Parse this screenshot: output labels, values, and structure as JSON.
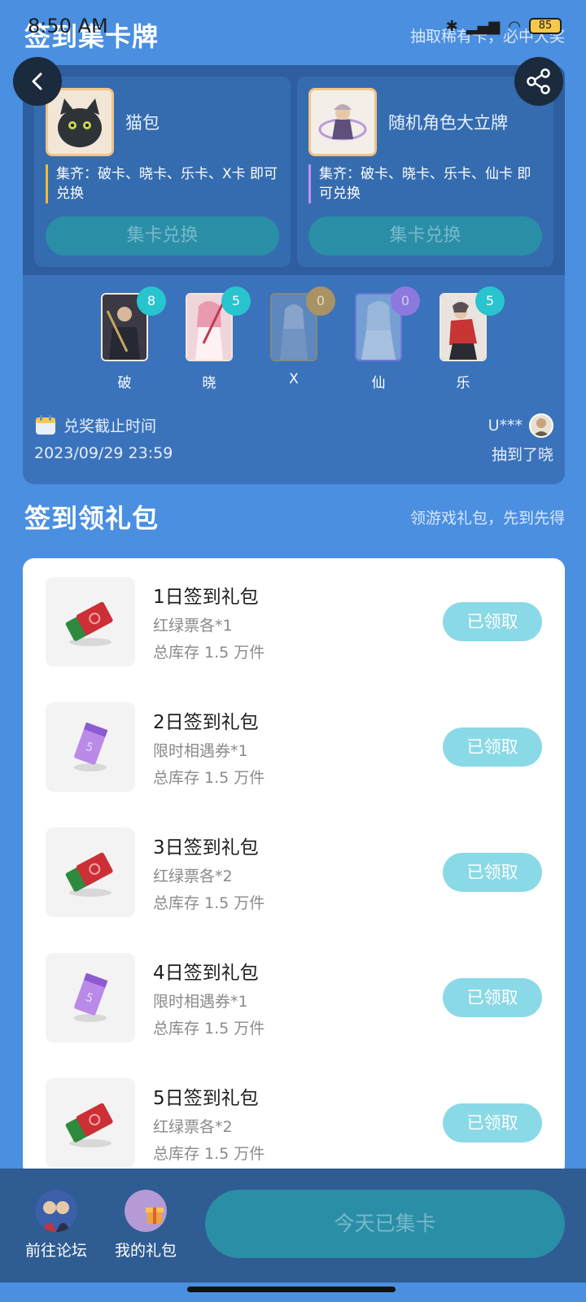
{
  "status_bar": {
    "time": "8:50 AM",
    "battery": "85"
  },
  "card_section": {
    "title": "签到集卡牌",
    "subtitle": "抽取稀有卡，必中大奖"
  },
  "rewards": [
    {
      "name": "猫包",
      "desc": "集齐：破卡、晓卡、乐卡、X卡 即可兑换",
      "button": "集卡兑换"
    },
    {
      "name": "随机角色大立牌",
      "desc": "集齐：破卡、晓卡、乐卡、仙卡 即可兑换",
      "button": "集卡兑换"
    }
  ],
  "cards": [
    {
      "label": "破",
      "count": "8"
    },
    {
      "label": "晓",
      "count": "5"
    },
    {
      "label": "X",
      "count": "0"
    },
    {
      "label": "仙",
      "count": "0"
    },
    {
      "label": "乐",
      "count": "5"
    }
  ],
  "deadline": {
    "label": "兑奖截止时间",
    "date": "2023/09/29 23:59"
  },
  "winner": {
    "user": "U***",
    "text": "抽到了晓"
  },
  "gift_section": {
    "title": "签到领礼包",
    "subtitle": "领游戏礼包，先到先得"
  },
  "gifts": [
    {
      "name": "1日签到礼包",
      "item": "红绿票各*1",
      "stock": "总库存 1.5 万件",
      "button": "已领取",
      "icon": "ticket-pair-icon"
    },
    {
      "name": "2日签到礼包",
      "item": "限时相遇券*1",
      "stock": "总库存 1.5 万件",
      "button": "已领取",
      "icon": "coupon-icon"
    },
    {
      "name": "3日签到礼包",
      "item": "红绿票各*2",
      "stock": "总库存 1.5 万件",
      "button": "已领取",
      "icon": "ticket-pair-icon"
    },
    {
      "name": "4日签到礼包",
      "item": "限时相遇券*1",
      "stock": "总库存 1.5 万件",
      "button": "已领取",
      "icon": "coupon-icon"
    },
    {
      "name": "5日签到礼包",
      "item": "红绿票各*2",
      "stock": "总库存 1.5 万件",
      "button": "已领取",
      "icon": "ticket-pair-icon"
    }
  ],
  "bottom_nav": {
    "forum": "前往论坛",
    "gifts": "我的礼包",
    "main_button": "今天已集卡"
  },
  "colors": {
    "background": "#4a8fe0",
    "panel": "#3a73bb",
    "claimed": "#8ad9e6",
    "disabled_button": "#2a8fa6"
  }
}
